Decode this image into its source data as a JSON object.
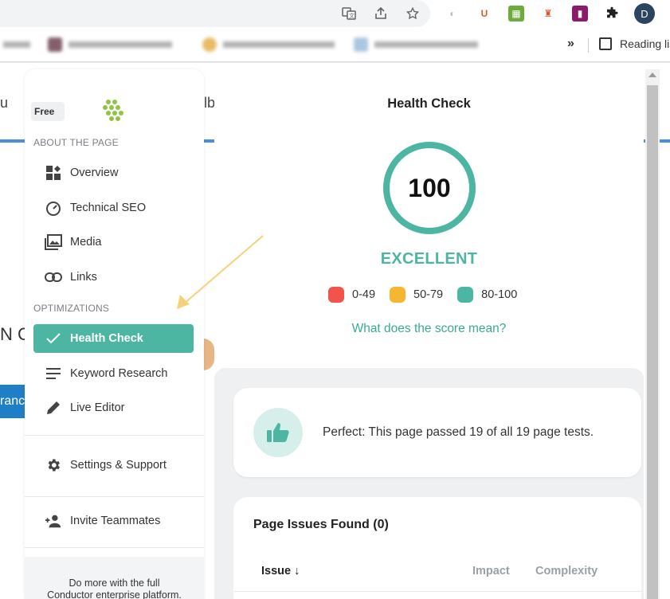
{
  "browser": {
    "profile_initial": "D",
    "extensions": [
      {
        "name": "translate-icon",
        "glyph": "G"
      },
      {
        "name": "share-icon",
        "glyph": "↗"
      },
      {
        "name": "star-icon",
        "glyph": "☆"
      }
    ],
    "ext_badges": [
      {
        "name": "seo-extension-icon",
        "glyph": "◐",
        "color": "#bbbbbb"
      },
      {
        "name": "ublock-extension-icon",
        "glyph": "U",
        "color": "#e0592a"
      },
      {
        "name": "grid-extension-icon",
        "glyph": "▦",
        "color": "#6dab3c"
      },
      {
        "name": "lighthouse-extension-icon",
        "glyph": "♜",
        "color": "#e5512d"
      },
      {
        "name": "metrics-extension-icon",
        "glyph": "▮",
        "color": "#8a1d6b"
      },
      {
        "name": "puzzle-extension-icon",
        "glyph": "✚",
        "color": "#202124"
      }
    ],
    "bookmarks_more": "»",
    "reading_list": "Reading list"
  },
  "background": {
    "text_left": "u",
    "text_right": "lb",
    "letters": "N C",
    "button_text": "ranc"
  },
  "sidebar": {
    "badge": "Free",
    "section_about": "ABOUT THE PAGE",
    "section_optimizations": "OPTIMIZATIONS",
    "items": {
      "overview": "Overview",
      "technical_seo": "Technical SEO",
      "media": "Media",
      "links": "Links",
      "health_check": "Health Check",
      "keyword_research": "Keyword Research",
      "live_editor": "Live Editor",
      "settings": "Settings & Support",
      "invite": "Invite Teammates"
    },
    "promo_line1": "Do more with the full",
    "promo_line2": "Conductor enterprise platform."
  },
  "main": {
    "title": "Health Check",
    "score": "100",
    "score_fraction": 1.0,
    "grade": "EXCELLENT",
    "legend": [
      {
        "label": "0-49",
        "color": "#f2534b"
      },
      {
        "label": "50-79",
        "color": "#f5b731"
      },
      {
        "label": "80-100",
        "color": "#4db6a2"
      }
    ],
    "score_link": "What does the score mean?",
    "pass_message": "Perfect: This page passed 19 of all 19 page tests.",
    "issues_title": "Page Issues Found (0)",
    "columns": {
      "issue": "Issue",
      "impact": "Impact",
      "complexity": "Complexity"
    }
  },
  "colors": {
    "accent": "#4db6a2",
    "annotation_arrow": "#f5d27a"
  }
}
